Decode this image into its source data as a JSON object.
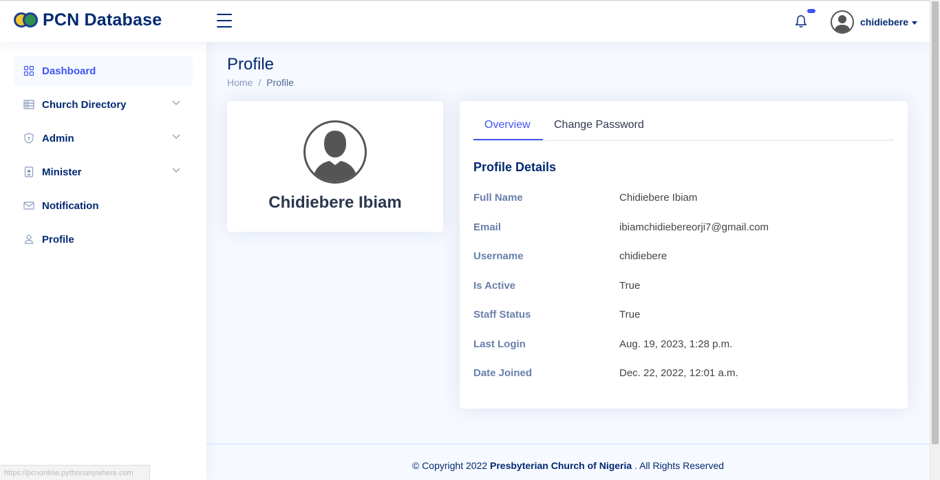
{
  "brand": {
    "title": "PCN Database"
  },
  "header": {
    "user_name": "chidiebere"
  },
  "sidebar": {
    "items": [
      {
        "label": "Dashboard"
      },
      {
        "label": "Church Directory"
      },
      {
        "label": "Admin"
      },
      {
        "label": "Minister"
      },
      {
        "label": "Notification"
      },
      {
        "label": "Profile"
      }
    ]
  },
  "page": {
    "title": "Profile",
    "breadcrumb": {
      "home": "Home",
      "separator": "/",
      "current": "Profile"
    }
  },
  "profile_card": {
    "name": "Chidiebere Ibiam"
  },
  "tabs": [
    {
      "label": "Overview",
      "active": true
    },
    {
      "label": "Change Password",
      "active": false
    }
  ],
  "details": {
    "title": "Profile Details",
    "rows": [
      {
        "key": "Full Name",
        "value": "Chidiebere Ibiam"
      },
      {
        "key": "Email",
        "value": "ibiamchidiebereorji7@gmail.com"
      },
      {
        "key": "Username",
        "value": "chidiebere"
      },
      {
        "key": "Is Active",
        "value": "True"
      },
      {
        "key": "Staff Status",
        "value": "True"
      },
      {
        "key": "Last Login",
        "value": "Aug. 19, 2023, 1:28 p.m."
      },
      {
        "key": "Date Joined",
        "value": "Dec. 22, 2022, 12:01 a.m."
      }
    ]
  },
  "footer": {
    "prefix": "© Copyright 2022",
    "org": "Presbyterian Church of Nigeria",
    "suffix": ". All Rights Reserved"
  },
  "status_bar": {
    "url": "https://pcnonline.pythonanywhere.com"
  },
  "colors": {
    "accent": "#4154f1",
    "brand": "#012970",
    "background": "#f6f9ff"
  },
  "icons": {
    "dashboard": "grid-icon",
    "church_directory": "server-icon",
    "admin": "shield-icon",
    "minister": "person-badge-icon",
    "notification": "envelope-icon",
    "profile": "person-icon"
  }
}
